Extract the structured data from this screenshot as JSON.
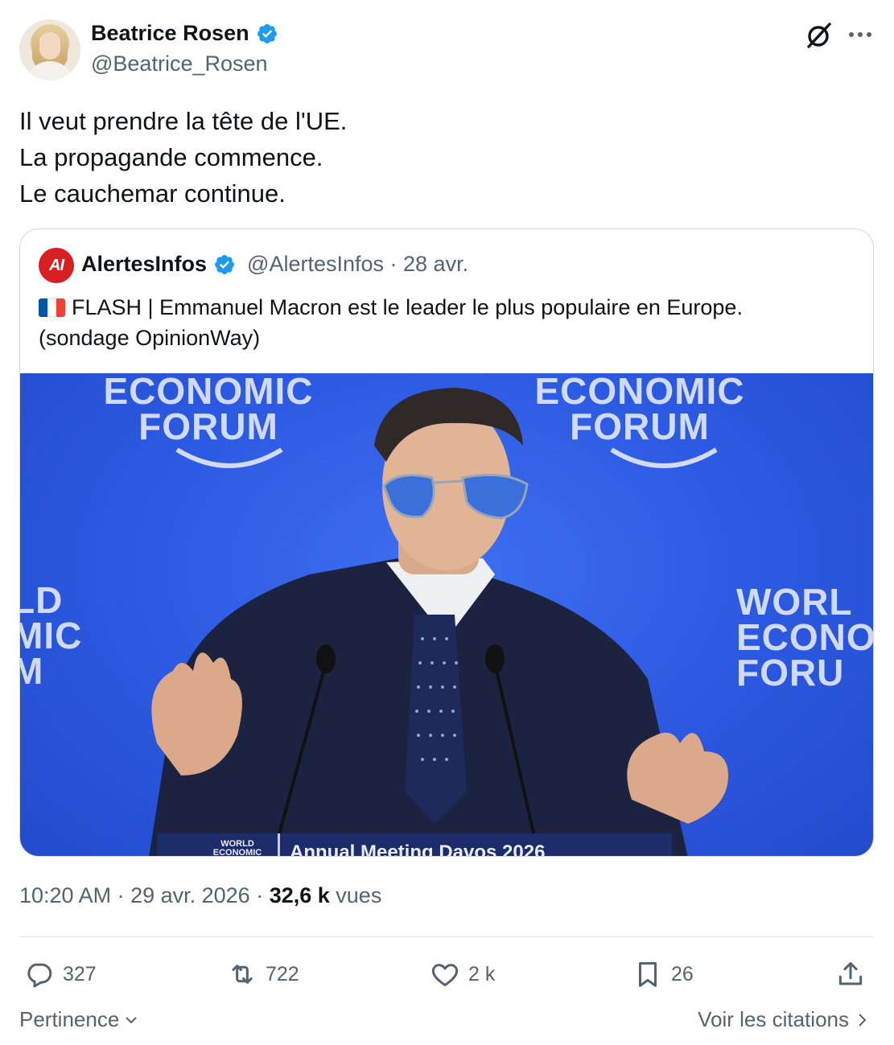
{
  "author": {
    "name": "Beatrice Rosen",
    "handle": "@Beatrice_Rosen",
    "verified": true
  },
  "tweet": {
    "lines": [
      "Il veut prendre la tête de l'UE.",
      "La propagande commence.",
      "Le cauchemar continue."
    ]
  },
  "quoted": {
    "avatar_text": "AI",
    "name": "AlertesInfos",
    "handle_date": "@AlertesInfos · 28 avr.",
    "verified": true,
    "text_line1": "FLASH | Emmanuel Macron est le leader le plus populaire en Europe.",
    "text_line2": "(sondage OpinionWay)",
    "flag_colors": [
      "#0055a4",
      "#ffffff",
      "#ef4135"
    ],
    "media": {
      "backdrop_left": "ECONOMIC FORUM",
      "backdrop_right": "ECONOMIC FORUM",
      "backdrop_far_left": "LD MIC M",
      "backdrop_far_right": "WORL ECONO FORU",
      "lectern_small": "WORLD ECONOMIC",
      "lectern_main": "Annual Meeting Davos 2026"
    }
  },
  "meta": {
    "time": "10:20 AM",
    "sep1": " · ",
    "date": "29 avr. 2026",
    "sep2": " · ",
    "views_count": "32,6 k",
    "views_label": " vues"
  },
  "actions": {
    "replies": "327",
    "reposts": "722",
    "likes": "2 k",
    "bookmarks": "26"
  },
  "footer": {
    "sort_label": "Pertinence",
    "quotes_label": "Voir les citations"
  },
  "colors": {
    "verified": "#1d9bf0",
    "secondary_text": "#536471",
    "primary_text": "#0f1419",
    "alertes_red": "#d81f26",
    "media_blue": "#2c5ae2"
  },
  "icons": [
    "verified-badge-icon",
    "grok-icon",
    "more-icon",
    "reply-icon",
    "repost-icon",
    "like-icon",
    "bookmark-icon",
    "share-icon",
    "chevron-down-icon",
    "chevron-right-icon"
  ]
}
